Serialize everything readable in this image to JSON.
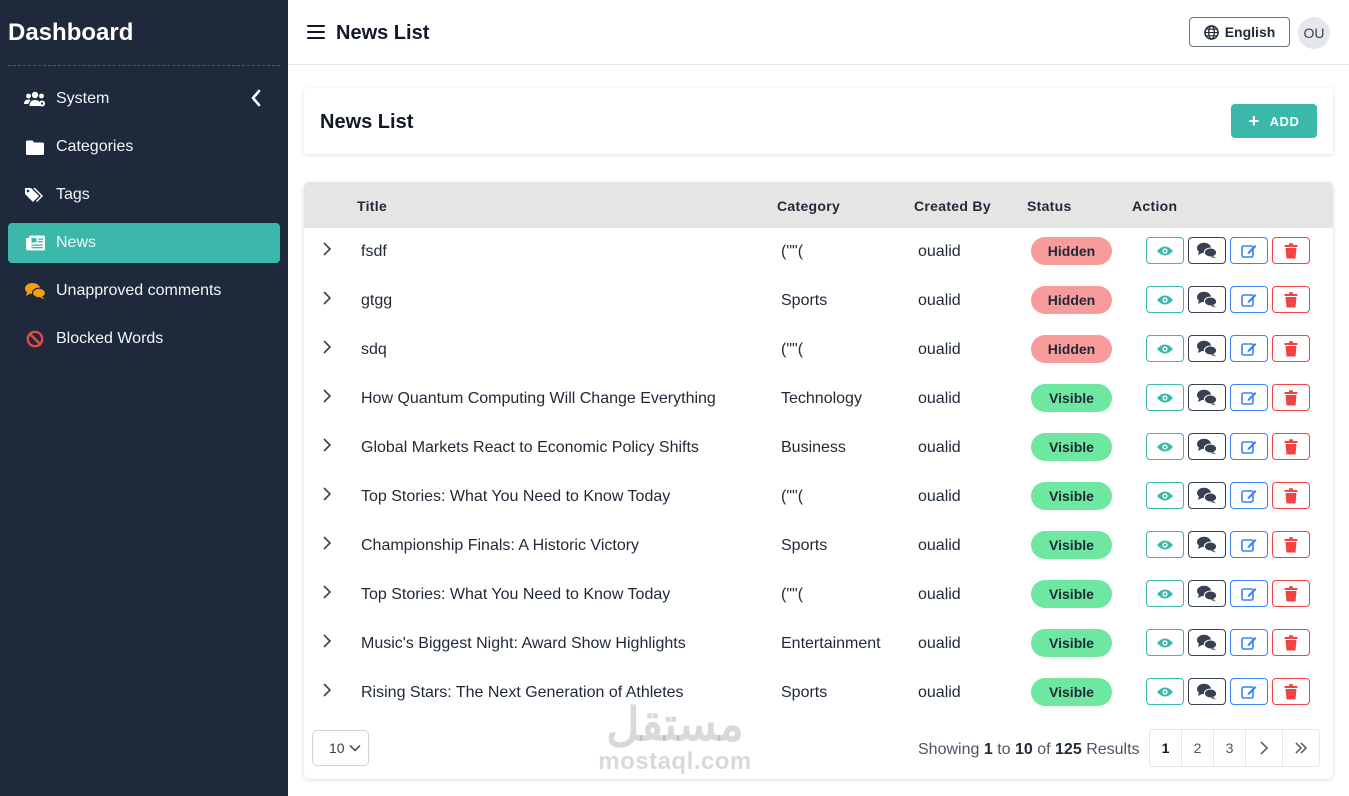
{
  "sidebar": {
    "brand": "Dashboard",
    "items": [
      {
        "label": "System",
        "icon": "users-cog-icon",
        "active": false,
        "has_chevron": true
      },
      {
        "label": "Categories",
        "icon": "folder-icon",
        "active": false
      },
      {
        "label": "Tags",
        "icon": "tags-icon",
        "active": false
      },
      {
        "label": "News",
        "icon": "newspaper-icon",
        "active": true
      },
      {
        "label": "Unapproved comments",
        "icon": "comments-icon",
        "active": false
      },
      {
        "label": "Blocked Words",
        "icon": "ban-icon",
        "active": false
      }
    ]
  },
  "topbar": {
    "title": "News List",
    "language": "English",
    "avatar": "OU"
  },
  "page": {
    "title": "News List",
    "add_label": "ADD"
  },
  "table": {
    "headers": {
      "title": "Title",
      "category": "Category",
      "created_by": "Created By",
      "status": "Status",
      "action": "Action"
    },
    "rows": [
      {
        "title": "fsdf",
        "category": "(\"\"(",
        "created_by": "oualid",
        "status": "Hidden"
      },
      {
        "title": "gtgg",
        "category": "Sports",
        "created_by": "oualid",
        "status": "Hidden"
      },
      {
        "title": "sdq",
        "category": "(\"\"(",
        "created_by": "oualid",
        "status": "Hidden"
      },
      {
        "title": "How Quantum Computing Will Change Everything",
        "category": "Technology",
        "created_by": "oualid",
        "status": "Visible"
      },
      {
        "title": "Global Markets React to Economic Policy Shifts",
        "category": "Business",
        "created_by": "oualid",
        "status": "Visible"
      },
      {
        "title": "Top Stories: What You Need to Know Today",
        "category": "(\"\"(",
        "created_by": "oualid",
        "status": "Visible"
      },
      {
        "title": "Championship Finals: A Historic Victory",
        "category": "Sports",
        "created_by": "oualid",
        "status": "Visible"
      },
      {
        "title": "Top Stories: What You Need to Know Today",
        "category": "(\"\"(",
        "created_by": "oualid",
        "status": "Visible"
      },
      {
        "title": "Music's Biggest Night: Award Show Highlights",
        "category": "Entertainment",
        "created_by": "oualid",
        "status": "Visible"
      },
      {
        "title": "Rising Stars: The Next Generation of Athletes",
        "category": "Sports",
        "created_by": "oualid",
        "status": "Visible"
      }
    ]
  },
  "footer": {
    "per_page": "10",
    "showing_prefix": "Showing",
    "from": "1",
    "to_word": "to",
    "to": "10",
    "of_word": "of",
    "total": "125",
    "results_word": "Results",
    "pages": [
      "1",
      "2",
      "3"
    ],
    "current_page": "1"
  },
  "watermark": {
    "arabic": "مستقل",
    "latin": "mostaql.com"
  },
  "colors": {
    "sidebar_bg": "#1e293b",
    "accent": "#3bb8a9",
    "hidden_badge": "#f79b9b",
    "visible_badge": "#6ee7a0",
    "comments_icon": "#f59e0b",
    "ban_icon": "#ef4444"
  }
}
